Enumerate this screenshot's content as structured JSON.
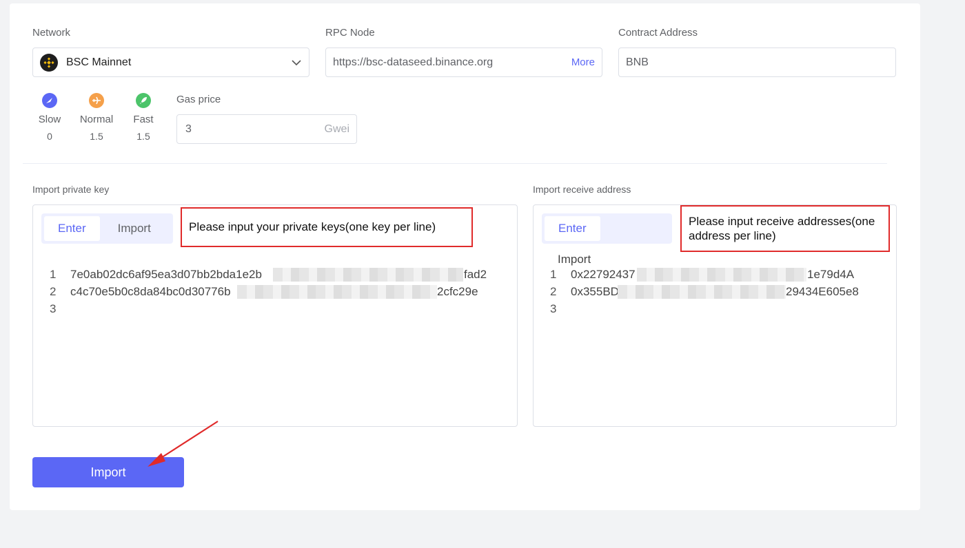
{
  "network": {
    "label": "Network",
    "selected": "BSC Mainnet"
  },
  "rpc": {
    "label": "RPC Node",
    "value": "https://bsc-dataseed.binance.org",
    "more": "More"
  },
  "contract": {
    "label": "Contract Address",
    "value": "BNB"
  },
  "speeds": [
    {
      "name": "Slow",
      "value": "0",
      "color": "#5b67f5",
      "icon": "bird-icon"
    },
    {
      "name": "Normal",
      "value": "1.5",
      "color": "#f5a04a",
      "icon": "plane-icon"
    },
    {
      "name": "Fast",
      "value": "1.5",
      "color": "#4cc46a",
      "icon": "rocket-icon"
    }
  ],
  "gas": {
    "label": "Gas price",
    "value": "3",
    "unit": "Gwei"
  },
  "private_key": {
    "label": "Import private key",
    "tabs": [
      "Enter",
      "Import"
    ],
    "callout": "Please input your private keys(one key per line)",
    "lines": [
      {
        "num": "1",
        "start": "7e0ab02dc6af95ea3d07bb2bda1e2b",
        "end": "fad2"
      },
      {
        "num": "2",
        "start": "c4c70e5b0c8da84bc0d30776b",
        "end": "2cfc29e"
      },
      {
        "num": "3",
        "start": "",
        "end": ""
      }
    ]
  },
  "receive": {
    "label": "Import receive address",
    "tabs": [
      "Enter"
    ],
    "import_text": "Import",
    "callout": "Please input receive addresses(one address per line)",
    "lines": [
      {
        "num": "1",
        "start": "0x22792437",
        "end": "1e79d4A"
      },
      {
        "num": "2",
        "start": "0x355BD",
        "end": "29434E605e8"
      },
      {
        "num": "3",
        "start": "",
        "end": ""
      }
    ]
  },
  "import_button": "Import",
  "colors": {
    "accent": "#5b67f5",
    "callout_border": "#e02a2a",
    "arrow": "#e02a2a"
  }
}
